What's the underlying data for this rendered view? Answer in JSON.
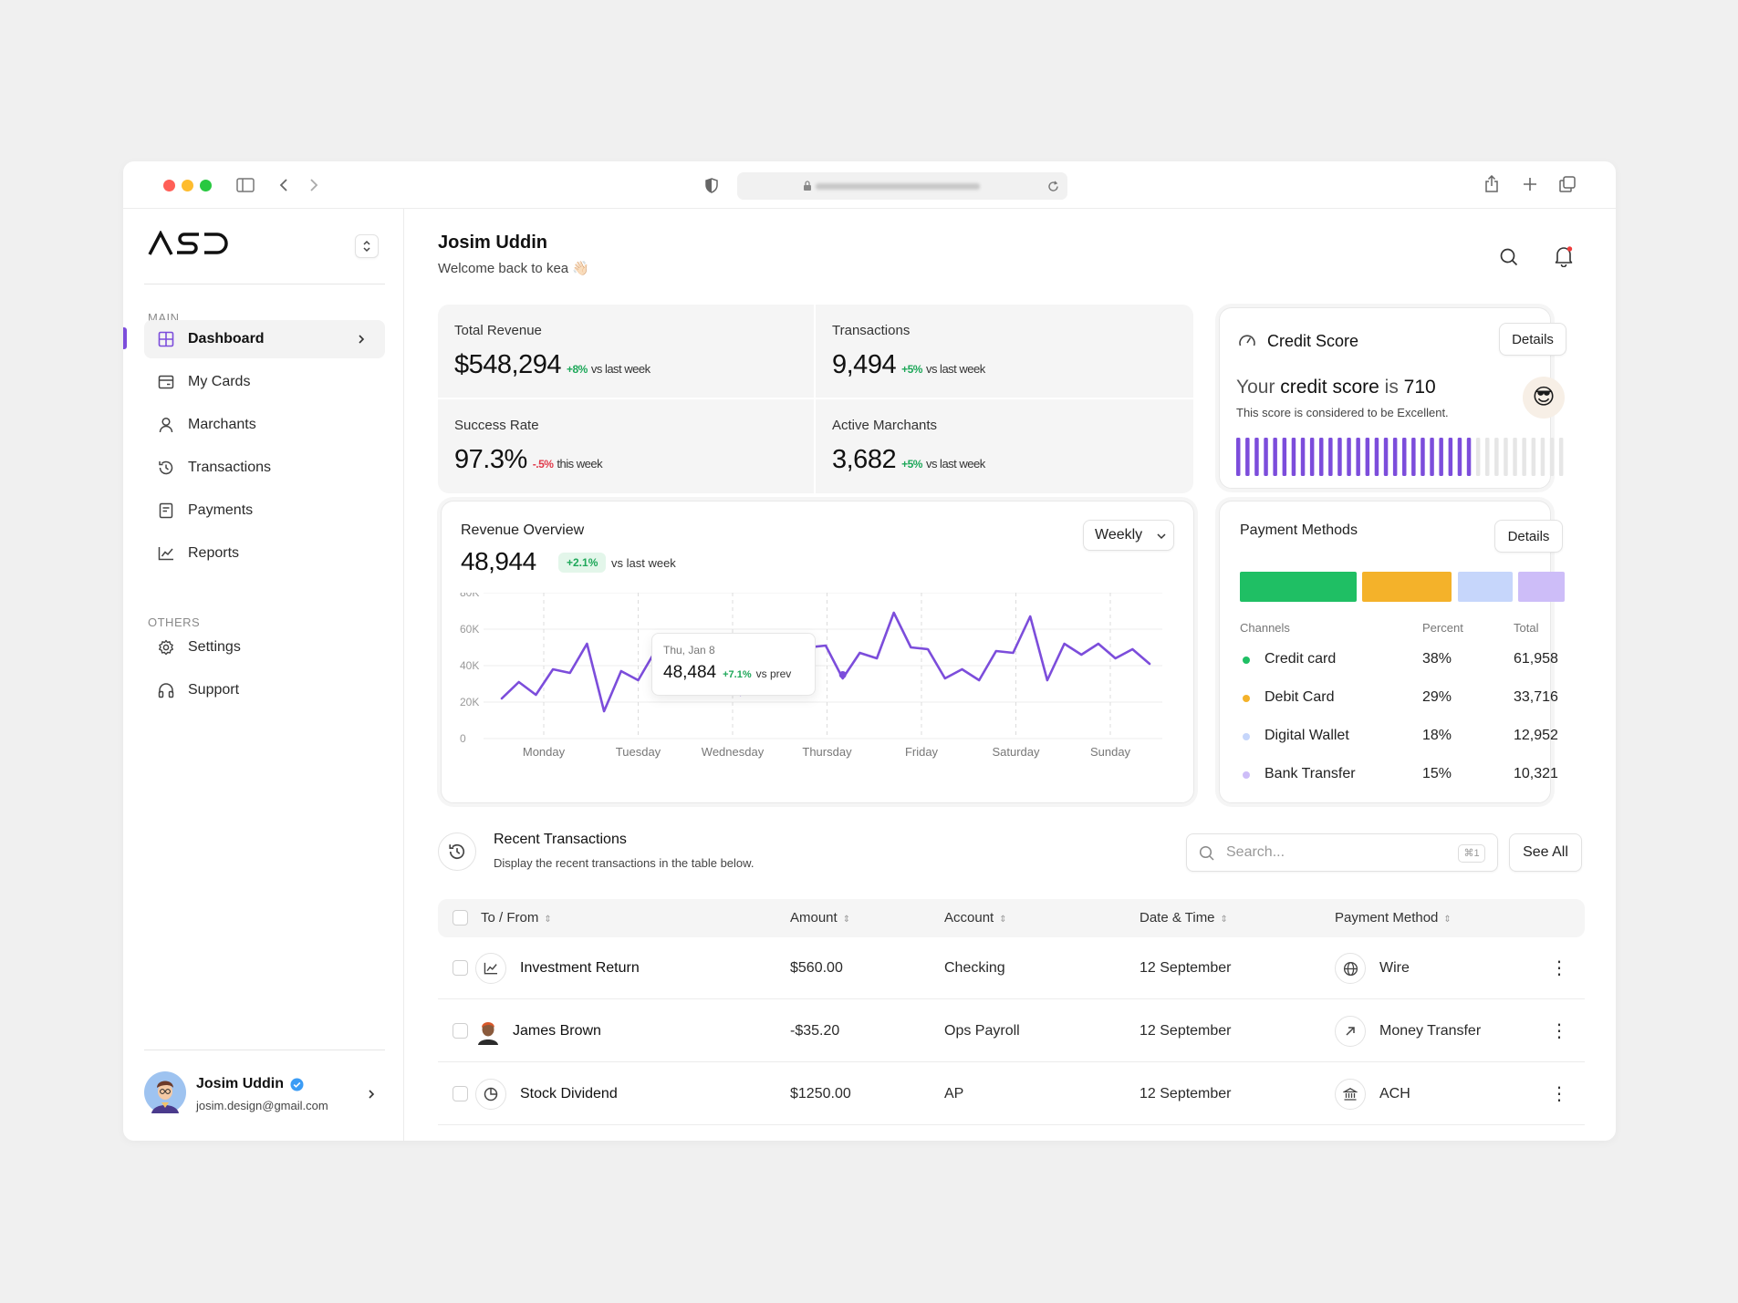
{
  "browser": {
    "url": "https://www.asd.com/admin"
  },
  "sidebar": {
    "logo": "ASD",
    "main_label": "MAIN",
    "main_items": [
      {
        "label": "Dashboard",
        "icon": "grid-icon"
      },
      {
        "label": "My Cards",
        "icon": "card-icon"
      },
      {
        "label": "Marchants",
        "icon": "user-icon"
      },
      {
        "label": "Transactions",
        "icon": "history-icon"
      },
      {
        "label": "Payments",
        "icon": "receipt-icon"
      },
      {
        "label": "Reports",
        "icon": "chart-line-icon"
      }
    ],
    "others_label": "OTHERS",
    "other_items": [
      {
        "label": "Settings",
        "icon": "gear-icon"
      },
      {
        "label": "Support",
        "icon": "headphones-icon"
      }
    ],
    "profile": {
      "name": "Josim Uddin",
      "email": "josim.design@gmail.com"
    }
  },
  "header": {
    "name": "Josim Uddin",
    "welcome": "Welcome back to kea 👋🏻"
  },
  "stats": [
    {
      "title": "Total Revenue",
      "value": "$548,294",
      "delta": "+8%",
      "sub": "vs last week",
      "positive": true
    },
    {
      "title": "Transactions",
      "value": "9,494",
      "delta": "+5%",
      "sub": "vs last week",
      "positive": true
    },
    {
      "title": "Success Rate",
      "value": "97.3%",
      "delta": "-.5%",
      "sub": "this week",
      "positive": false
    },
    {
      "title": "Active Marchants",
      "value": "3,682",
      "delta": "+5%",
      "sub": "vs last week",
      "positive": true
    }
  ],
  "credit": {
    "title": "Credit Score",
    "details": "Details",
    "line_prefix": "Your ",
    "line_bold": "credit score",
    "line_mid": " is ",
    "score": "710",
    "desc": "This score is considered to be Excellent.",
    "emoji": "😎",
    "filled_fraction": 0.71
  },
  "revenue": {
    "title": "Revenue Overview",
    "value": "48,944",
    "delta": "+2.1%",
    "sub": "vs last week",
    "period": "Weekly",
    "tooltip": {
      "date": "Thu, Jan 8",
      "value": "48,484",
      "delta": "+7.1%",
      "sub": "vs prev"
    }
  },
  "chart_data": {
    "type": "line",
    "title": "Revenue Overview",
    "x_labels": [
      "Monday",
      "Tuesday",
      "Wednesday",
      "Thursday",
      "Friday",
      "Saturday",
      "Sunday"
    ],
    "y_ticks": [
      "80K",
      "60K",
      "40K",
      "20K",
      "0"
    ],
    "ylim": [
      0,
      80000
    ],
    "grid": true,
    "color": "#7c4ddb",
    "values": [
      22000,
      31000,
      24000,
      38000,
      36000,
      52000,
      15000,
      37000,
      32000,
      48000,
      47000,
      46000,
      40000,
      31000,
      24000,
      36000,
      33000,
      48000,
      50000,
      51000,
      33000,
      47000,
      44000,
      69000,
      50000,
      49000,
      33000,
      38000,
      32000,
      48000,
      47000,
      67000,
      32000,
      52000,
      46000,
      52000,
      44000,
      49000,
      41000
    ]
  },
  "payment_methods": {
    "title": "Payment Methods",
    "details": "Details",
    "headers": [
      "Channels",
      "Percent",
      "Total"
    ],
    "rows": [
      {
        "channel": "Credit card",
        "percent": "38%",
        "total": "61,958",
        "color": "#1fbf64"
      },
      {
        "channel": "Debit Card",
        "percent": "29%",
        "total": "33,716",
        "color": "#f4b22a"
      },
      {
        "channel": "Digital Wallet",
        "percent": "18%",
        "total": "12,952",
        "color": "#c6d6fb"
      },
      {
        "channel": "Bank Transfer",
        "percent": "15%",
        "total": "10,321",
        "color": "#cdbdf8"
      }
    ]
  },
  "transactions": {
    "title": "Recent Transactions",
    "subtitle": "Display the recent transactions in the table below.",
    "search_placeholder": "Search...",
    "shortcut": "⌘1",
    "see_all": "See All",
    "columns": [
      "To / From",
      "Amount",
      "Account",
      "Date & Time",
      "Payment Method"
    ],
    "rows": [
      {
        "name": "Investment Return",
        "amount": "$560.00",
        "account": "Checking",
        "date": "12 September",
        "method": "Wire",
        "icon": "chart-line-icon",
        "method_icon": "globe-icon"
      },
      {
        "name": "James Brown",
        "amount": "-$35.20",
        "account": "Ops Payroll",
        "date": "12 September",
        "method": "Money Transfer",
        "icon": "avatar",
        "method_icon": "arrow-up-right-icon"
      },
      {
        "name": "Stock Dividend",
        "amount": "$1250.00",
        "account": "AP",
        "date": "12 September",
        "method": "ACH",
        "icon": "pie-icon",
        "method_icon": "bank-icon"
      }
    ]
  }
}
